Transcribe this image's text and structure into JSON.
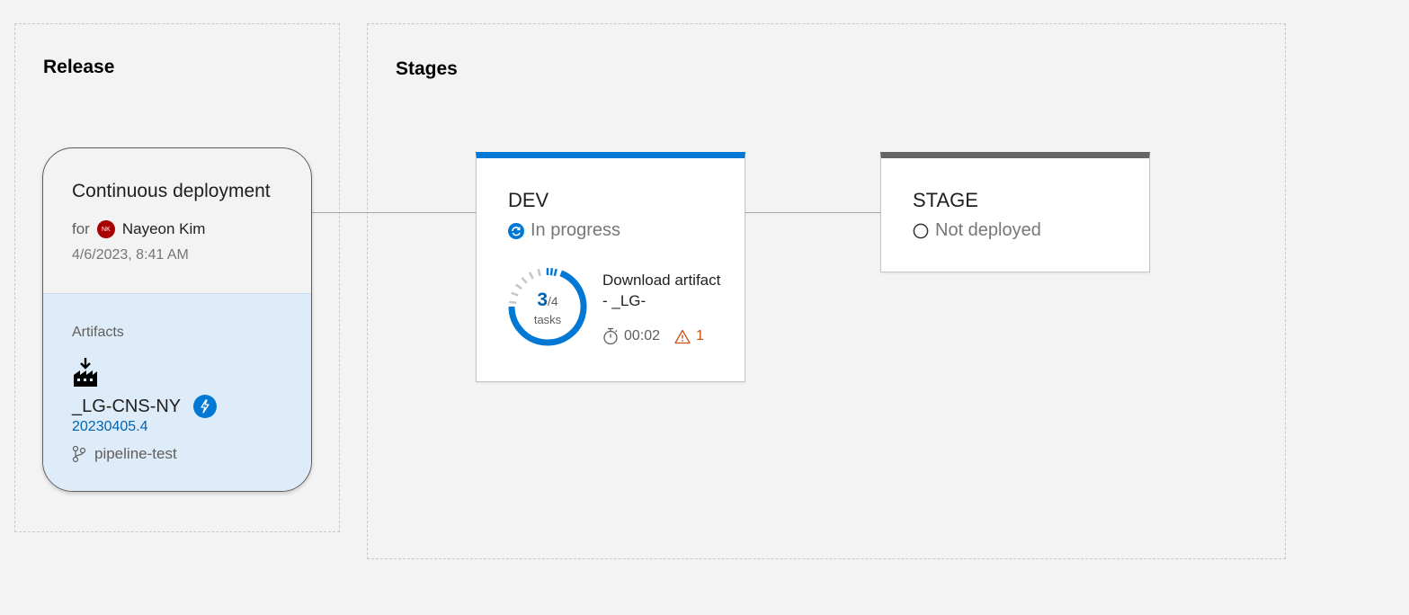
{
  "release_panel": {
    "title": "Release"
  },
  "stages_panel": {
    "title": "Stages"
  },
  "trigger": {
    "title": "Continuous deployment",
    "for_label": "for",
    "user_initials": "NK",
    "user_name": "Nayeon Kim",
    "date": "4/6/2023, 8:41 AM"
  },
  "artifacts": {
    "label": "Artifacts",
    "name": "_LG-CNS-NY",
    "version": "20230405.4",
    "branch": "pipeline-test",
    "icon": "build-artifact-icon",
    "trigger_icon": "lightning-bolt-icon"
  },
  "stages": [
    {
      "name": "DEV",
      "status": "In progress",
      "status_icon": "in-progress-icon",
      "accent": "#0078d4",
      "tasks_done": "3",
      "tasks_total": "/4",
      "tasks_label": "tasks",
      "progress_fraction": 0.75,
      "current_task": "Download artifact - _LG-",
      "duration": "00:02",
      "warnings": "1"
    },
    {
      "name": "STAGE",
      "status": "Not deployed",
      "status_icon": "not-deployed-icon",
      "accent": "#666666"
    }
  ],
  "colors": {
    "accent_blue": "#0078d4",
    "warning": "#ca5010",
    "artifact_bg": "#deecf9"
  }
}
